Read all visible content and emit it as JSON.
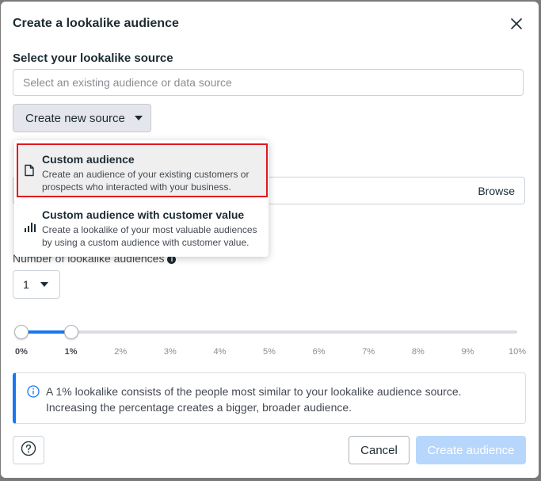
{
  "dialog": {
    "title": "Create a lookalike audience",
    "close_icon": "close-icon"
  },
  "source": {
    "label": "Select your lookalike source",
    "placeholder": "Select an existing audience or data source",
    "value": "",
    "create_new_label": "Create new source"
  },
  "menu": {
    "items": [
      {
        "icon": "document-icon",
        "title": "Custom audience",
        "description": "Create an audience of your existing customers or prospects who interacted with your business.",
        "highlighted": true
      },
      {
        "icon": "bar-chart-icon",
        "title": "Custom audience with customer value",
        "description": "Create a lookalike of your most valuable audiences by using a custom audience with customer value.",
        "highlighted": false
      }
    ]
  },
  "location": {
    "browse_label": "Browse"
  },
  "audiences": {
    "label": "Number of lookalike audiences",
    "value": "1"
  },
  "slider": {
    "ticks": [
      "0%",
      "1%",
      "2%",
      "3%",
      "4%",
      "5%",
      "6%",
      "7%",
      "8%",
      "9%",
      "10%"
    ],
    "range_start_percent": 0,
    "range_end_percent": 1,
    "accent_color": "#1877f2"
  },
  "info": {
    "text": "A 1% lookalike consists of the people most similar to your lookalike audience source. Increasing the percentage creates a bigger, broader audience."
  },
  "footer": {
    "help_icon": "help-icon",
    "cancel_label": "Cancel",
    "create_label": "Create audience",
    "create_color": "#b7d6fb"
  }
}
